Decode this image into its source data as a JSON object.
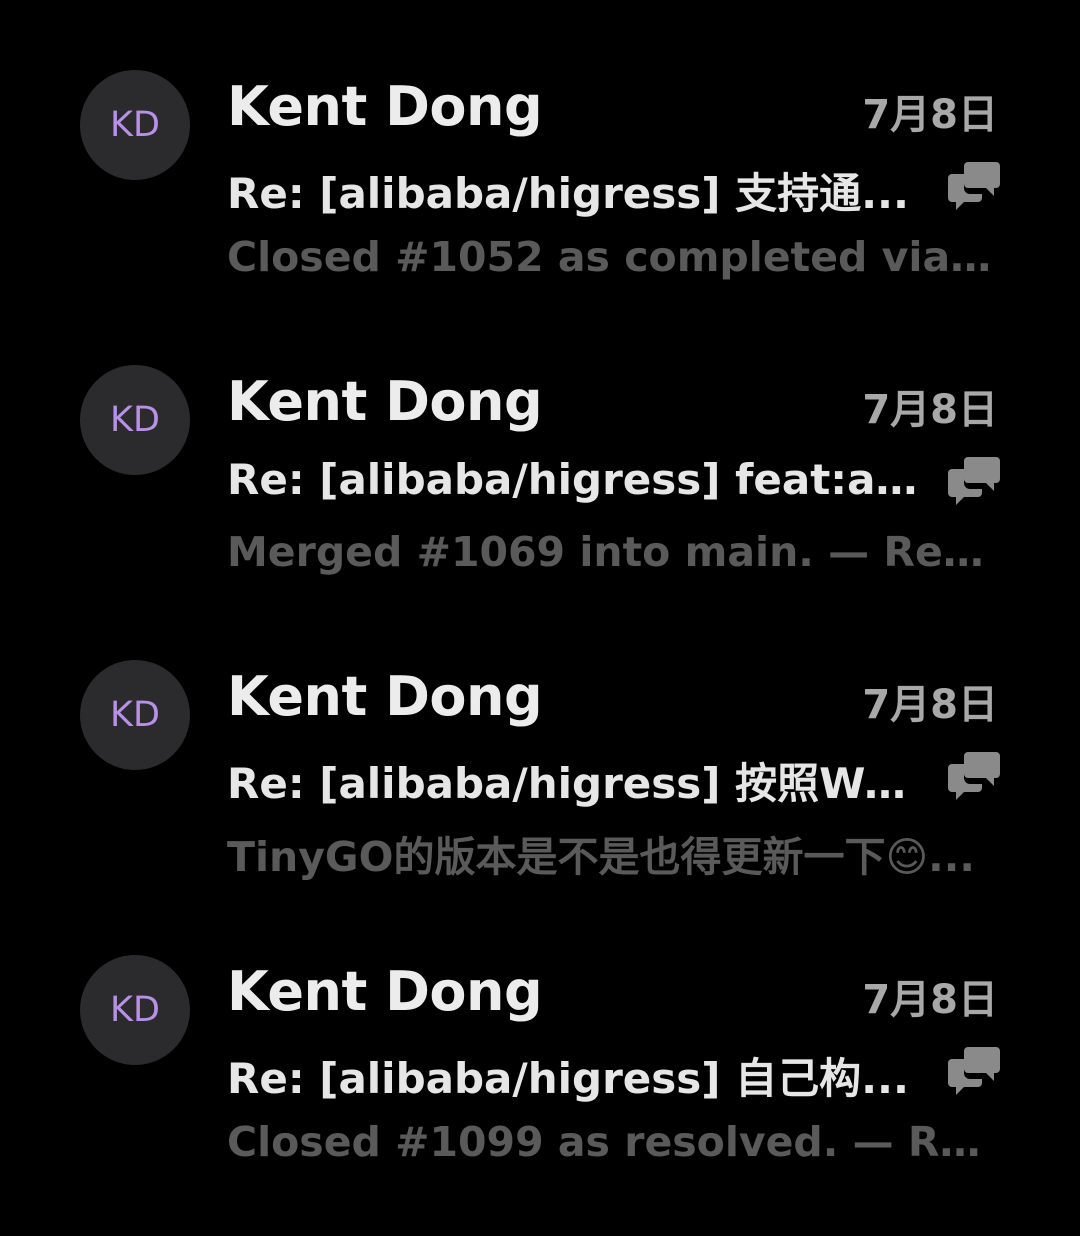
{
  "mail_list": [
    {
      "avatar_initials": "KD",
      "sender": "Kent Dong",
      "date": "7月8日",
      "subject": "Re: [alibaba/higress] 支持通...",
      "preview": "Closed #1052 as completed via #1...",
      "thread_icon": "conversation-icon"
    },
    {
      "avatar_initials": "KD",
      "sender": "Kent Dong",
      "date": "7月8日",
      "subject": "Re: [alibaba/higress] feat:ad...",
      "preview": "Merged #1069 into main. — Reply ...",
      "thread_icon": "conversation-icon"
    },
    {
      "avatar_initials": "KD",
      "sender": "Kent Dong",
      "date": "7月8日",
      "subject": "Re: [alibaba/higress] 按照Wa...",
      "preview": "TinyGO的版本是不是也得更新一下😊...",
      "thread_icon": "conversation-icon"
    },
    {
      "avatar_initials": "KD",
      "sender": "Kent Dong",
      "date": "7月8日",
      "subject": "Re: [alibaba/higress] 自己构...",
      "preview": "Closed #1099 as resolved. — Repl...",
      "thread_icon": "conversation-icon"
    }
  ],
  "colors": {
    "background": "#000000",
    "avatar_bg": "#2b2b2d",
    "avatar_text": "#b890e8",
    "sender_text": "#ececec",
    "date_text": "#a8a8a8",
    "subject_text": "#e6e6e6",
    "preview_text": "#5a5a5a",
    "icon": "#8a8a8a"
  }
}
